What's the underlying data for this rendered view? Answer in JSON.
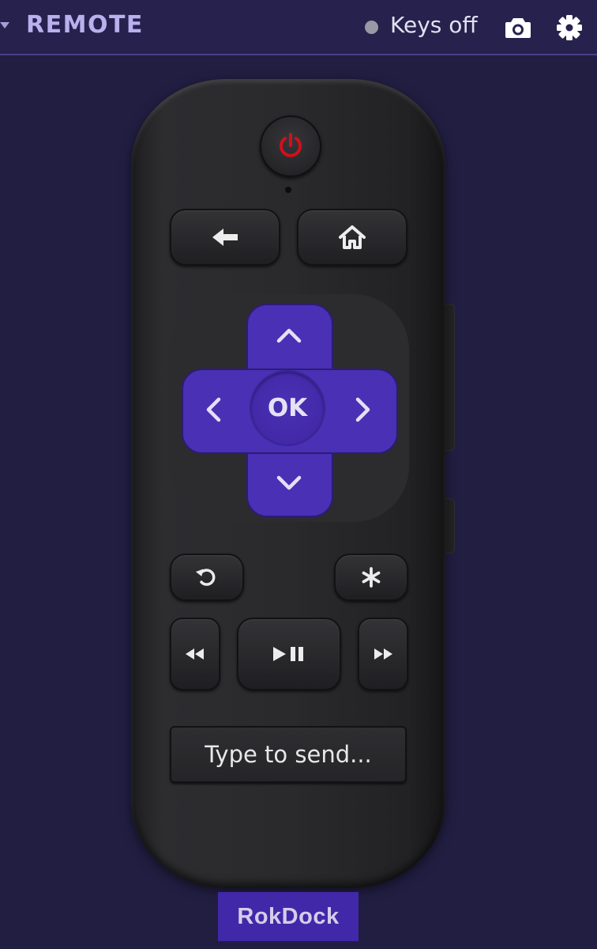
{
  "header": {
    "title": "REMOTE",
    "status_text": "Keys off",
    "status_color": "#9a98a6",
    "icons": [
      "chevron-down-icon",
      "camera-icon",
      "gear-icon"
    ]
  },
  "remote": {
    "accent_color": "#4a30b4",
    "power_color": "#d0101a",
    "ok_label": "OK",
    "type_placeholder": "Type to send...",
    "brand_label": "RokDock",
    "buttons": [
      "power",
      "back",
      "home",
      "up",
      "down",
      "left",
      "right",
      "ok",
      "replay",
      "options",
      "rewind",
      "play-pause",
      "fast-forward"
    ]
  }
}
